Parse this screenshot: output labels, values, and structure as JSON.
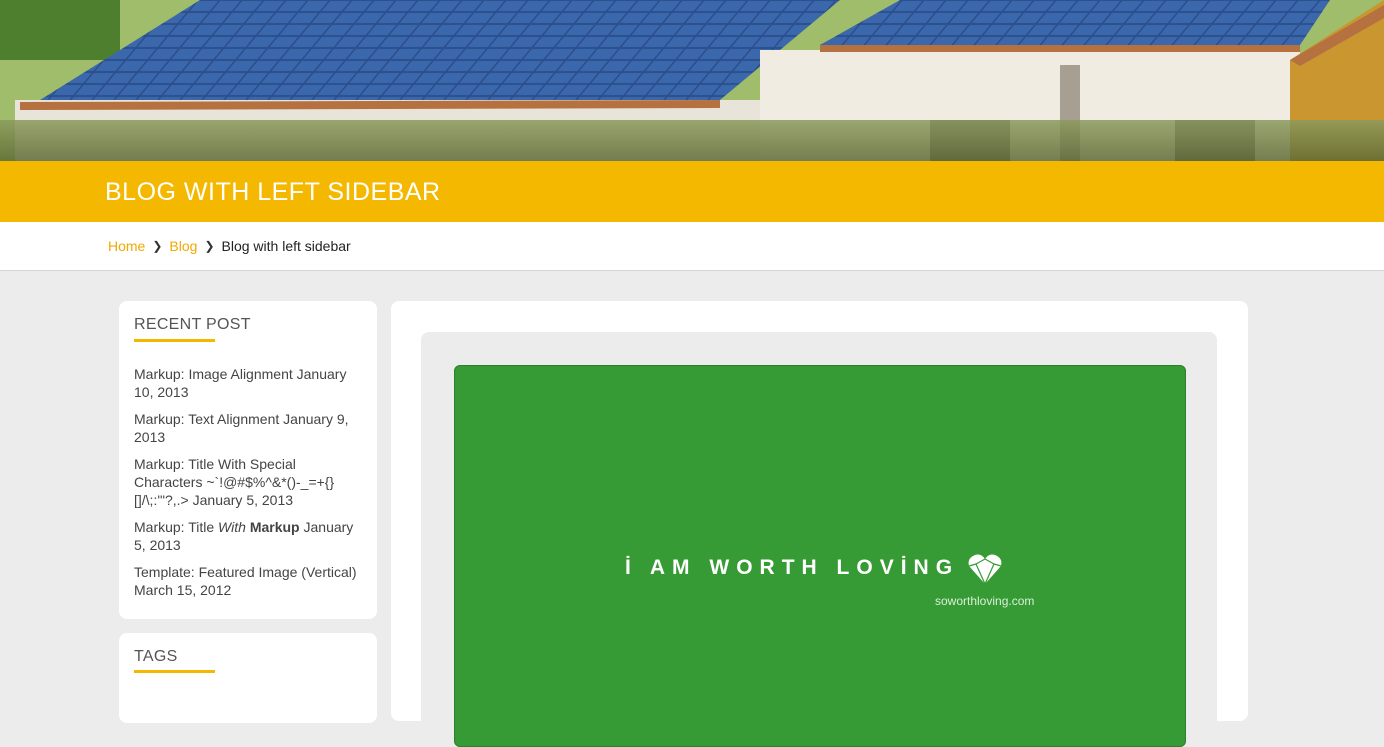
{
  "page": {
    "title": "BLOG WITH LEFT SIDEBAR"
  },
  "breadcrumb": {
    "items": [
      "Home",
      "Blog"
    ],
    "current": "Blog with left sidebar"
  },
  "sidebar": {
    "recent": {
      "heading": "RECENT POST",
      "posts": [
        {
          "title": "Markup: Image Alignment",
          "date": "January 10, 2013"
        },
        {
          "title": "Markup: Text Alignment",
          "date": "January 9, 2013"
        },
        {
          "title": "Markup: Title With Special Characters ~`!@#$%^&*()-_=+{}[]/\\;:'\"?,.>",
          "date": "January 5, 2013"
        },
        {
          "title_parts": [
            "Markup: Title ",
            "With",
            " ",
            "Markup"
          ],
          "date": "January 5, 2013"
        },
        {
          "title": "Template: Featured Image (Vertical)",
          "date": "March 15, 2012"
        }
      ]
    },
    "tags": {
      "heading": "TAGS"
    }
  },
  "featured": {
    "slogan": "İ AM WORTH LOVİNG",
    "site": "soworthloving.com",
    "background_color": "#379b35",
    "icon": "diamond-heart-icon"
  },
  "colors": {
    "accent": "#f5b800",
    "link": "#f2a900"
  }
}
